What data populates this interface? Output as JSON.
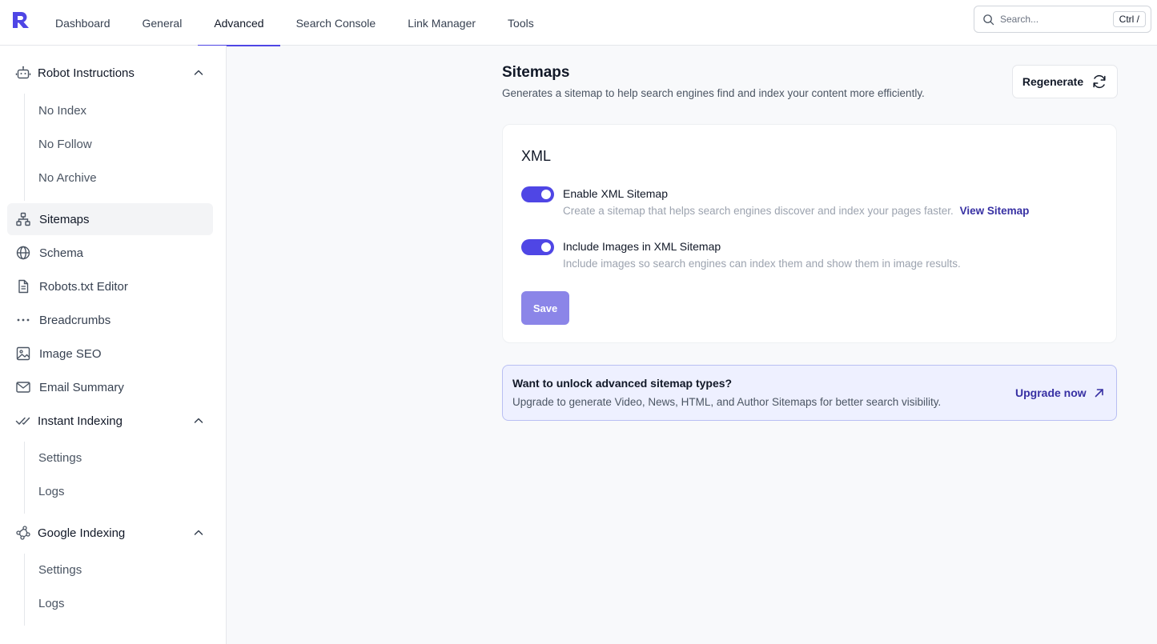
{
  "header": {
    "tabs": [
      {
        "label": "Dashboard"
      },
      {
        "label": "General"
      },
      {
        "label": "Advanced"
      },
      {
        "label": "Search Console"
      },
      {
        "label": "Link Manager"
      },
      {
        "label": "Tools"
      }
    ],
    "active_tab": "Advanced",
    "search": {
      "placeholder": "Search...",
      "shortcut": "Ctrl /"
    }
  },
  "sidebar": {
    "robot_instructions": {
      "label": "Robot Instructions",
      "children": [
        "No Index",
        "No Follow",
        "No Archive"
      ]
    },
    "items": [
      {
        "label": "Sitemaps",
        "icon": "sitemap-icon"
      },
      {
        "label": "Schema",
        "icon": "globe-icon"
      },
      {
        "label": "Robots.txt Editor",
        "icon": "file-text-icon"
      },
      {
        "label": "Breadcrumbs",
        "icon": "dots-horizontal-icon"
      },
      {
        "label": "Image SEO",
        "icon": "image-icon"
      },
      {
        "label": "Email Summary",
        "icon": "mail-icon"
      }
    ],
    "active_item": "Sitemaps",
    "instant_indexing": {
      "label": "Instant Indexing",
      "children": [
        "Settings",
        "Logs"
      ]
    },
    "google_indexing": {
      "label": "Google Indexing",
      "children": [
        "Settings",
        "Logs"
      ]
    }
  },
  "main": {
    "title": "Sitemaps",
    "description": "Generates a sitemap to help search engines find and index your content more efficiently.",
    "regenerate_label": "Regenerate",
    "card": {
      "title": "XML",
      "options": [
        {
          "label": "Enable XML Sitemap",
          "help": "Create a sitemap that helps search engines discover and index your pages faster.",
          "link": "View Sitemap",
          "enabled": true
        },
        {
          "label": "Include Images in XML Sitemap",
          "help": "Include images so search engines can index them and show them in image results.",
          "enabled": true
        }
      ],
      "save_label": "Save"
    },
    "upsell": {
      "title": "Want to unlock advanced sitemap types?",
      "description": "Upgrade to generate Video, News, HTML, and Author Sitemaps for better search visibility.",
      "link": "Upgrade now"
    }
  },
  "colors": {
    "accent": "#4f46e5",
    "save_button": "#8b85e8",
    "link": "#3730a3",
    "upsell_bg": "#eef0ff",
    "upsell_border": "#b9bff3"
  }
}
